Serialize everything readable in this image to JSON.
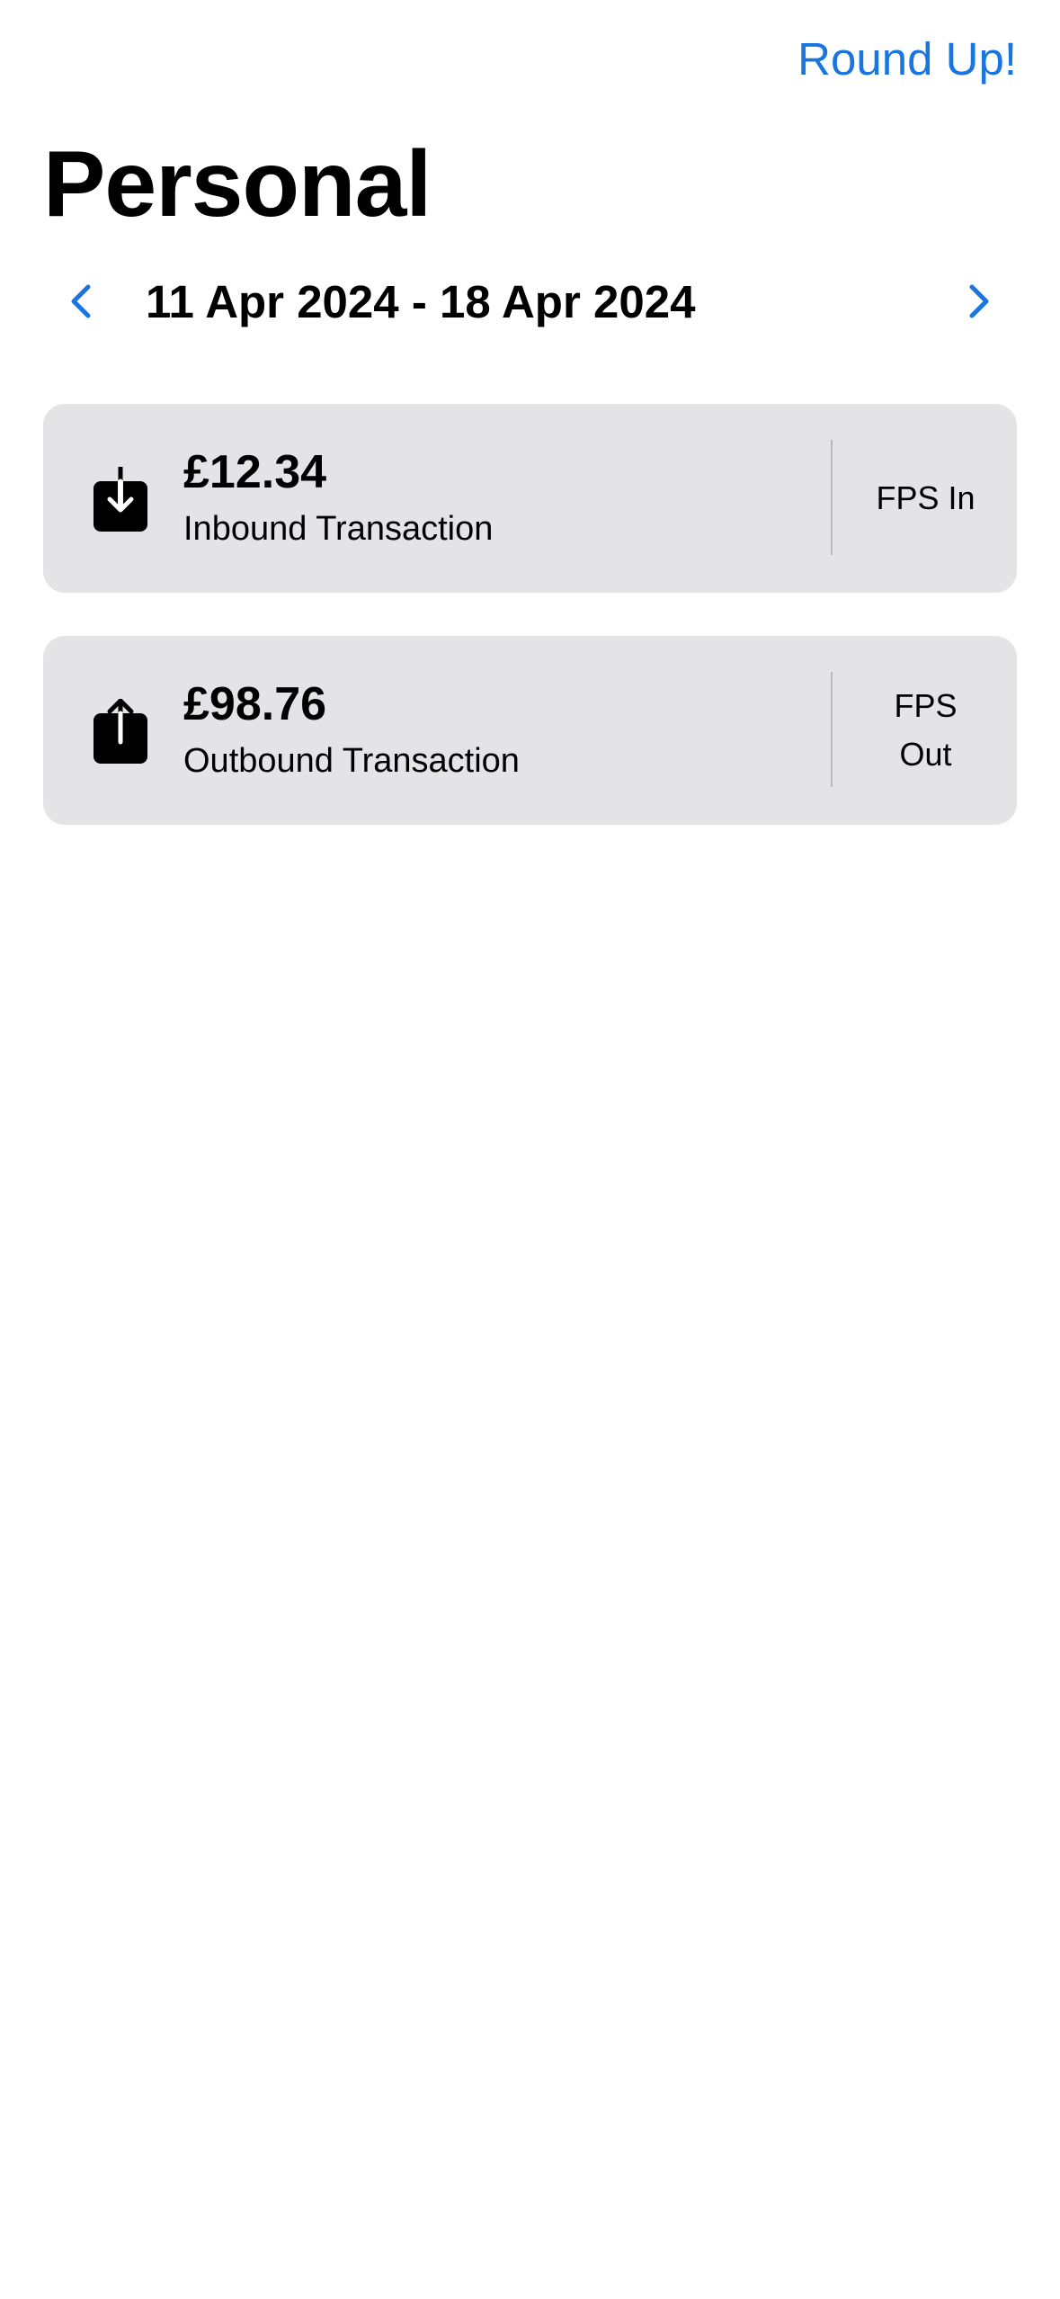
{
  "header": {
    "action_label": "Round Up!",
    "title": "Personal"
  },
  "date_nav": {
    "range_label": "11 Apr 2024 - 18 Apr 2024",
    "prev_icon": "chevron-left-icon",
    "next_icon": "chevron-right-icon",
    "accent_color": "#1976e0"
  },
  "transactions": [
    {
      "icon": "tray-arrow-down-icon",
      "amount": "£12.34",
      "description": "Inbound Transaction",
      "type": "FPS In"
    },
    {
      "icon": "tray-arrow-up-icon",
      "amount": "£98.76",
      "description": "Outbound Transaction",
      "type": "FPS Out"
    }
  ],
  "colors": {
    "card_background": "#e4e4e6",
    "accent": "#1976e0"
  }
}
